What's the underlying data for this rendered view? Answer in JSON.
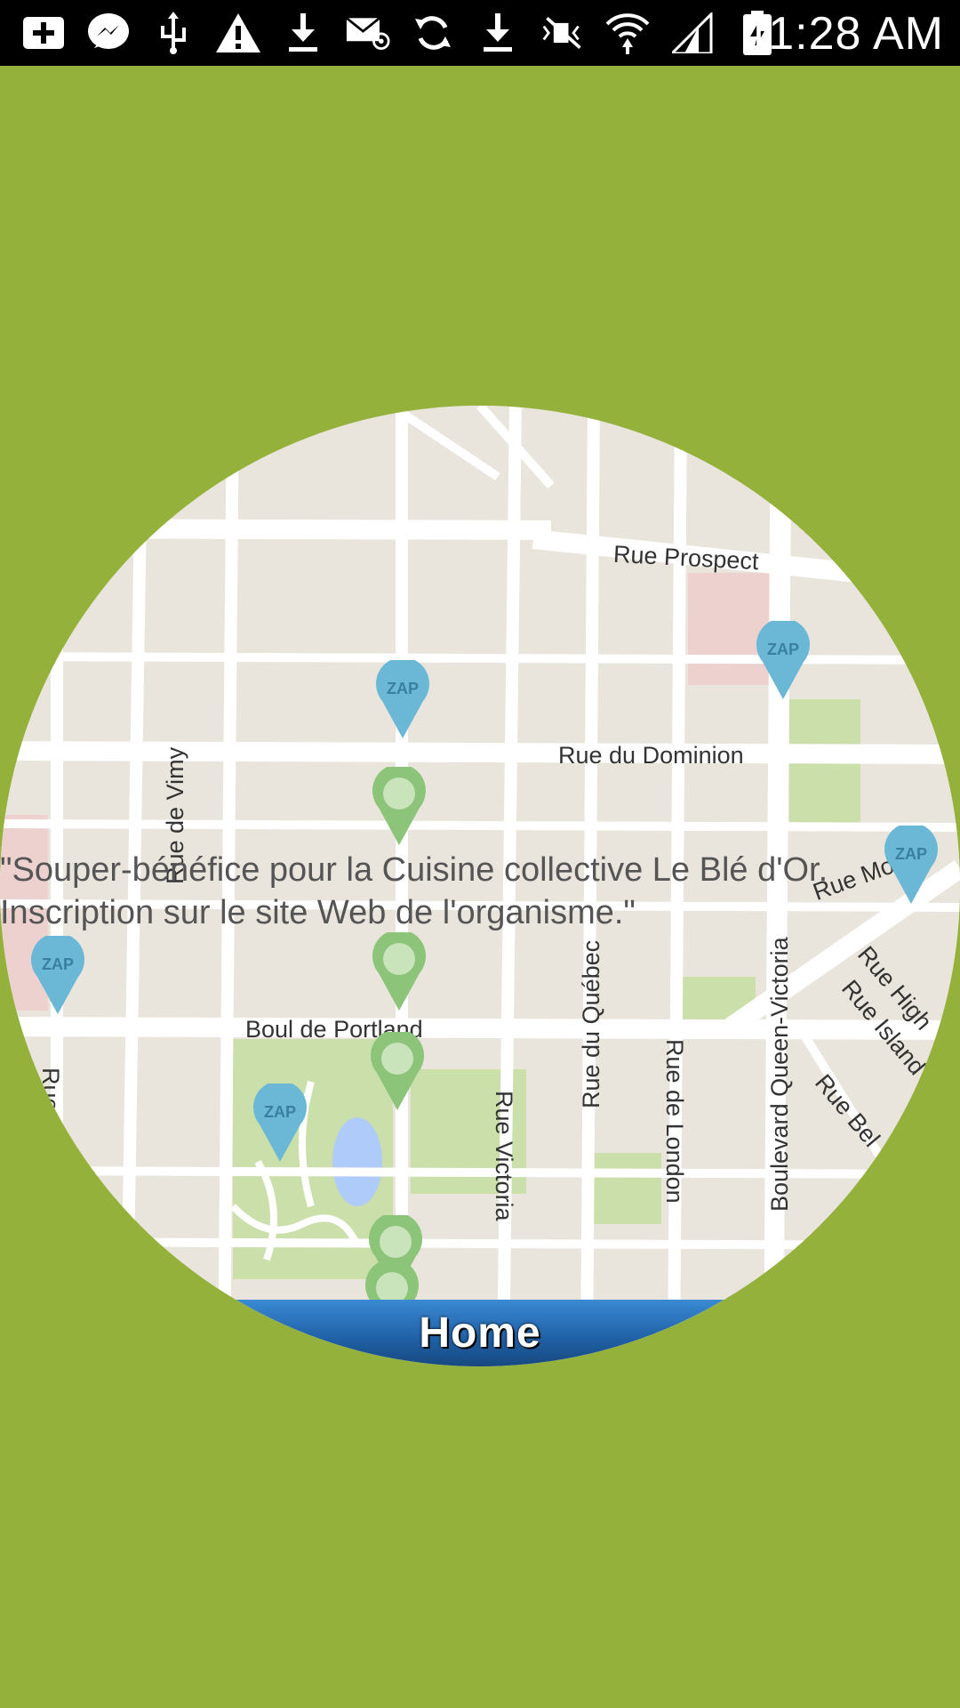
{
  "status_bar": {
    "time": "11:28 AM",
    "icons": [
      "add-icon",
      "messenger-icon",
      "usb-icon",
      "warning-icon",
      "download-icon",
      "email-icon",
      "sync-icon",
      "download-icon",
      "mute-icon",
      "wifi-icon",
      "signal-icon",
      "battery-charging-icon"
    ]
  },
  "map": {
    "streets": {
      "prospect": "Rue Prospect",
      "dominion": "Rue du Dominion",
      "vimy": "Rue de Vimy",
      "portland": "Boul de Portland",
      "victoria": "Rue Victoria",
      "quebec": "Rue du Québec",
      "london": "Rue de London",
      "queen_victoria": "Boulevard Queen-Victoria",
      "moore": "Rue Moore",
      "high": "Rue High",
      "island": "Rue Island",
      "bel": "Rue Bel",
      "rue_left": "Rue"
    },
    "marker_label": "ZAP",
    "colors": {
      "land": "#e9e5dc",
      "park": "#cadfaa",
      "water": "#aecbfa",
      "road": "#ffffff",
      "marker_blue": "#6bb8d6",
      "marker_green": "#8cc47a"
    }
  },
  "event_text": "\"Souper-bénéfice pour la Cuisine collective Le Blé d'Or.\nInscription sur le site Web de l'organisme.\"",
  "home_button": {
    "label": "Home"
  }
}
